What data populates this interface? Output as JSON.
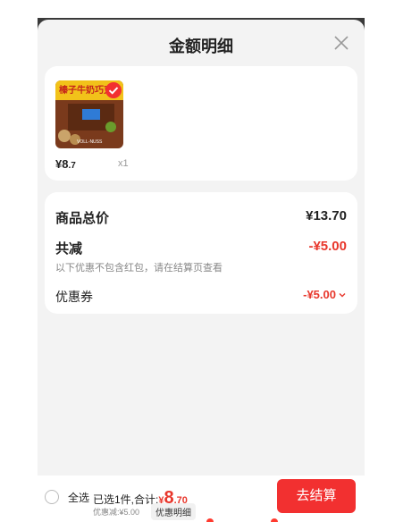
{
  "header": {
    "title": "金额明细"
  },
  "product": {
    "image_text_top": "榛子牛奶巧克力",
    "image_text_bottom": "VOLL-NUSS",
    "price_main": "¥8",
    "price_decimal": ".7",
    "quantity": "x1"
  },
  "summary": {
    "total_label": "商品总价",
    "total_value": "¥13.70",
    "reduce_label": "共减",
    "reduce_value": "-¥5.00",
    "note": "以下优惠不包含红包，请在结算页查看",
    "coupon_label": "优惠券",
    "coupon_value": "-¥5.00"
  },
  "footer": {
    "select_all": "全选",
    "selected_prefix": "已选1件,合计:",
    "total_symbol": "¥",
    "total_int": "8",
    "total_dec": ".70",
    "discount_text": "优惠减:¥5.00",
    "detail_chip": "优惠明细",
    "checkout": "去结算"
  },
  "colors": {
    "accent": "#f23030",
    "price_red": "#e8372c"
  }
}
